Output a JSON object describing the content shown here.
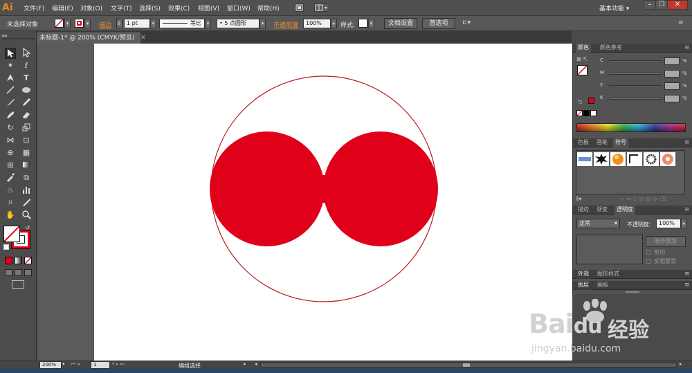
{
  "app": {
    "logo": "Ai"
  },
  "menu": [
    "文件(F)",
    "编辑(E)",
    "对象(O)",
    "文字(T)",
    "选择(S)",
    "效果(C)",
    "视图(V)",
    "窗口(W)",
    "帮助(H)"
  ],
  "workspace": "基本功能",
  "control": {
    "selection": "未选择对象",
    "stroke_label": "描边",
    "stroke_weight": "1 pt",
    "profile": "等比",
    "brush": "5 点圆形",
    "opacity_label": "不透明度",
    "opacity_value": "100%",
    "style_label": "样式:",
    "doc_setup": "文档设置",
    "prefs": "首选项"
  },
  "document": {
    "tab_title": "未标题-1* @ 200% (CMYK/预览)"
  },
  "color_panel": {
    "tabs": [
      "颜色",
      "颜色参考"
    ],
    "channels": [
      "C",
      "M",
      "Y",
      "K"
    ],
    "unit": "%"
  },
  "symbols_panel": {
    "tabs": [
      "色板",
      "画笔",
      "符号"
    ]
  },
  "transparency_panel": {
    "tabs": [
      "描边",
      "渐变",
      "透明度"
    ],
    "blend_mode": "正常",
    "opacity_label": "不透明度:",
    "opacity_value": "100%",
    "make_mask": "制作蒙版",
    "clip": "剪切",
    "invert": "反相蒙版"
  },
  "appearance_panel": {
    "tabs": [
      "外观",
      "图形样式"
    ]
  },
  "layers_panel": {
    "tabs": [
      "图层",
      "画板"
    ]
  },
  "status": {
    "zoom": "200%",
    "page": "1",
    "mode": "编组选择"
  },
  "colors": {
    "red": "#e10019",
    "outline": "#c0161e",
    "accent": "#e8902a"
  },
  "watermark": {
    "brand": "Bai",
    "brand2": "du",
    "cn": "经验",
    "url": "jingyan.baidu.com"
  }
}
